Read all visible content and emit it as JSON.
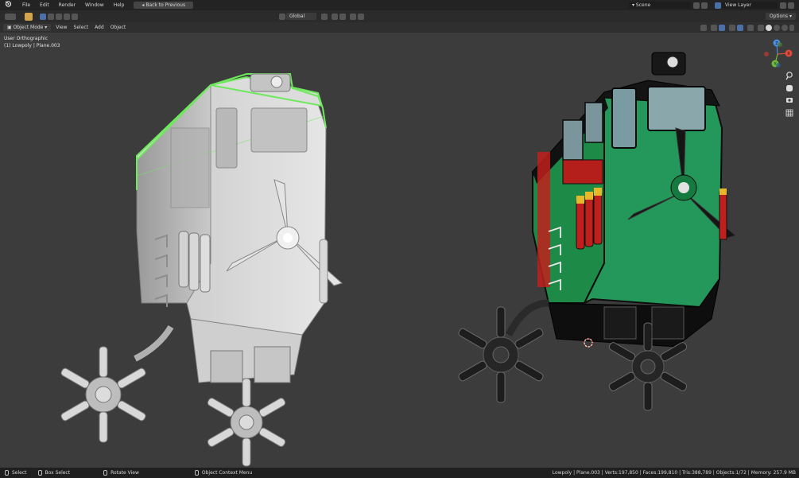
{
  "menu": [
    "File",
    "Edit",
    "Render",
    "Window",
    "Help"
  ],
  "back_button": "Back to Previous",
  "scene_name": "Scene",
  "view_layer": "View Layer",
  "transform_orientation": "Global",
  "options_label": "Options",
  "mode": "Object Mode",
  "header_menus": [
    "View",
    "Select",
    "Add",
    "Object"
  ],
  "viewport": {
    "view_name": "User Orthographic",
    "object_info": "(1) Lowpoly | Plane.003",
    "axes": {
      "x": "X",
      "y": "Y",
      "z": "Z"
    }
  },
  "status": {
    "left": [
      {
        "icon": "left-mouse-icon",
        "label": "Select"
      },
      {
        "icon": "left-mouse-icon",
        "label": "Box Select"
      },
      {
        "icon": "middle-mouse-icon",
        "label": "Rotate View"
      },
      {
        "icon": "right-mouse-icon",
        "label": "Object Context Menu"
      }
    ],
    "stats": "Lowpoly | Plane.003 | Verts:197,850 | Faces:199,810 | Tris:388,789 | Objects:1/72 | Memory: 257.9 MB"
  },
  "colors": {
    "accent_blue": "#4b6fa8",
    "selection_green": "#6ee85c",
    "paint_green": "#1e8a48",
    "paint_red": "#c0201d",
    "paint_yellow": "#e6b82a"
  }
}
